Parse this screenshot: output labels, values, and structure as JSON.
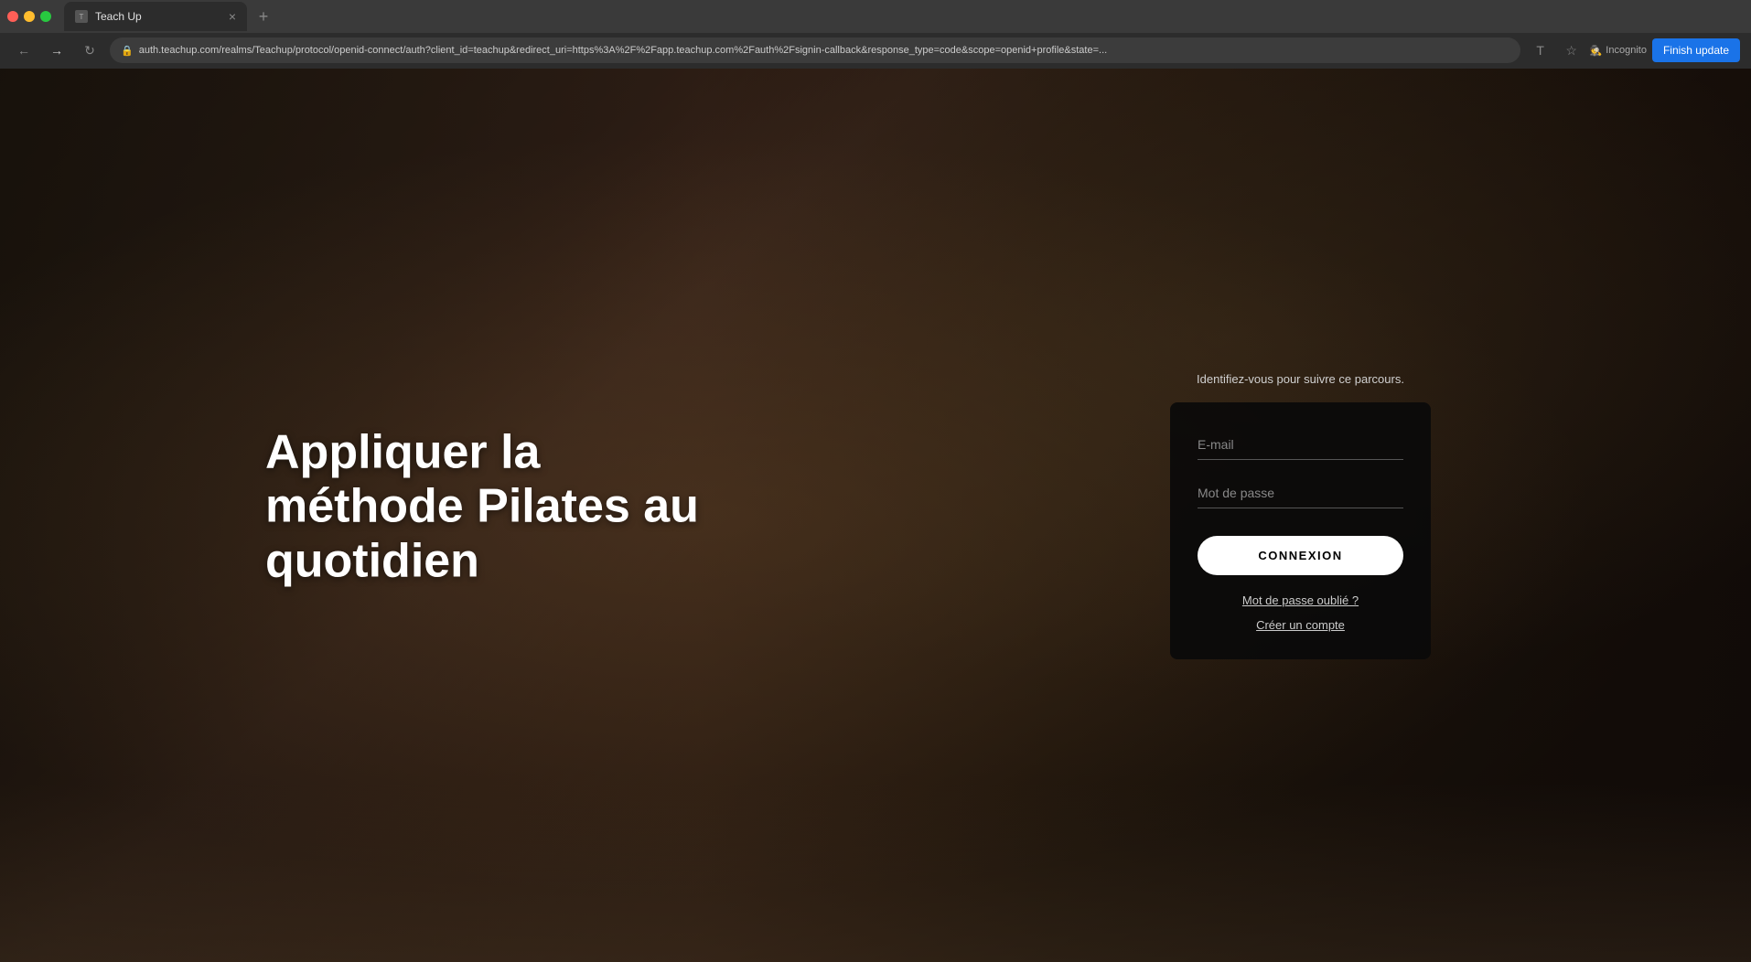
{
  "browser": {
    "tab_title": "Teach Up",
    "address": "auth.teachup.com/realms/Teachup/protocol/openid-connect/auth?client_id=teachup&redirect_uri=https%3A%2F%2Fapp.teachup.com%2Fauth%2Fsignin-callback&response_type=code&scope=openid+profile&state=...",
    "incognito_label": "Incognito",
    "finish_update_label": "Finish update",
    "tab_close": "×",
    "new_tab": "+"
  },
  "page": {
    "tagline_line1": "Appliquer la méthode Pilates au",
    "tagline_line2": "quotidien",
    "subtitle": "Identifiez-vous pour suivre ce parcours.",
    "email_placeholder": "E-mail",
    "password_placeholder": "Mot de passe",
    "login_button": "CONNEXION",
    "forgot_password": "Mot de passe oublié ?",
    "create_account": "Créer un compte"
  },
  "colors": {
    "accent": "#1a73e8",
    "login_btn_bg": "#ffffff",
    "login_btn_text": "#000000",
    "form_bg": "rgba(10,10,10,0.92)"
  }
}
